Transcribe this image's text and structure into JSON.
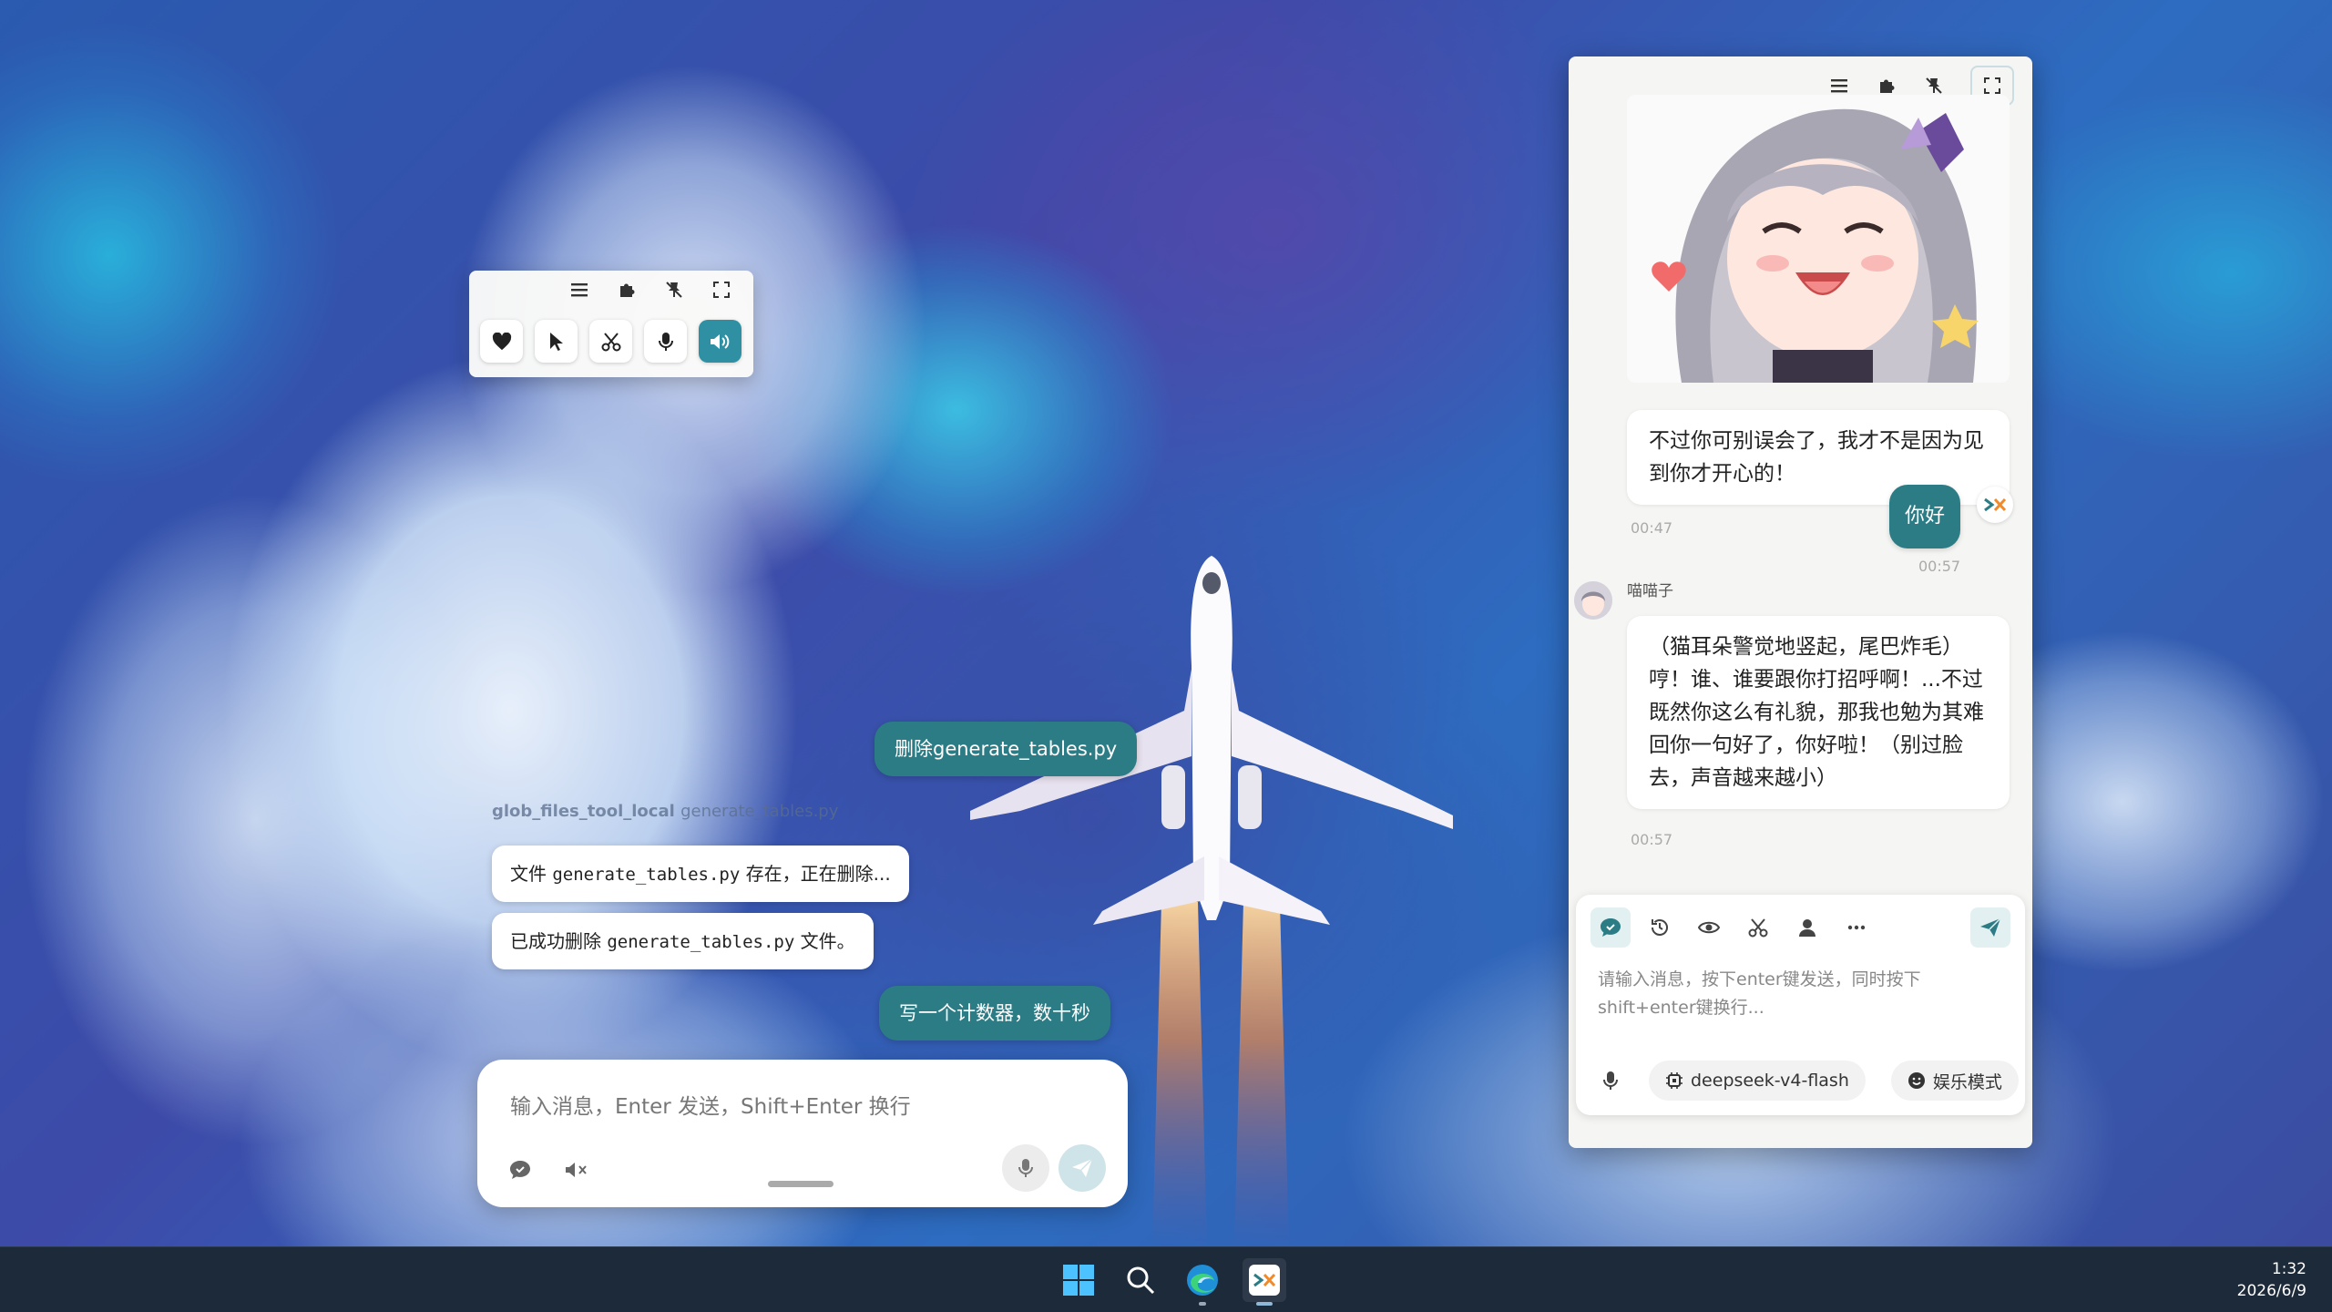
{
  "mini_toolbar": {
    "top_icons": [
      "menu-icon",
      "puzzle-icon",
      "pin-off-icon",
      "fullscreen-icon"
    ],
    "buttons": [
      "heart-icon",
      "cursor-icon",
      "scissors-icon",
      "mic-icon",
      "speaker-icon"
    ],
    "active_button": "speaker-icon"
  },
  "left_chat": {
    "user_delete": "删除generate_tables.py",
    "tool_name": "glob_files_tool_local",
    "tool_file": "generate_tables.py",
    "bot_msg1_pre": "文件 ",
    "bot_msg1_code": "generate_tables.py",
    "bot_msg1_post": " 存在，正在删除...",
    "bot_msg2_pre": "已成功删除 ",
    "bot_msg2_code": "generate_tables.py",
    "bot_msg2_post": " 文件。",
    "user_counter": "写一个计数器，数十秒",
    "input_placeholder": "输入消息，Enter 发送，Shift+Enter 换行"
  },
  "chat_window": {
    "bot_text1": "不过你可别误会了，我才不是因为见到你才开心的！",
    "ts1": "00:47",
    "user_text": "你好",
    "ts2": "00:57",
    "bot_name": "喵喵子",
    "bot_text2": "（猫耳朵警觉地竖起，尾巴炸毛）哼！谁、谁要跟你打招呼啊！...不过既然你这么有礼貌，那我也勉为其难回你一句好了，你好啦！（别过脸去，声音越来越小）",
    "ts3": "00:57",
    "input_placeholder": "请输入消息，按下enter键发送，同时按下shift+enter键换行...",
    "model": "deepseek-v4-flash",
    "mode": "娱乐模式",
    "accent": "#2c7c86"
  },
  "taskbar": {
    "apps": [
      "windows-start-icon",
      "search-icon",
      "edge-browser-icon",
      "chat-app-icon"
    ],
    "time": "1:32",
    "date": "2026/6/9"
  }
}
